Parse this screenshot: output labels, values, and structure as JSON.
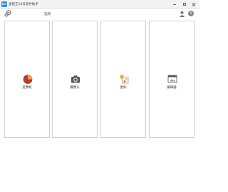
{
  "window": {
    "app_icon_text": "DIY",
    "title": "金银王10号软件助手"
  },
  "toolbar": {
    "options_label": "选项",
    "info_icon_text": "i"
  },
  "panels": [
    {
      "label": "变像机",
      "icon": "mic-ball-icon"
    },
    {
      "label": "摄像头",
      "icon": "camera-icon"
    },
    {
      "label": "图标",
      "icon": "image-icon"
    },
    {
      "label": "编辑器",
      "icon": "editor-window-icon"
    }
  ],
  "colors": {
    "accent": "#2d8cf0",
    "border": "#cfcfcf",
    "titlebar": "#f3f3f3"
  }
}
